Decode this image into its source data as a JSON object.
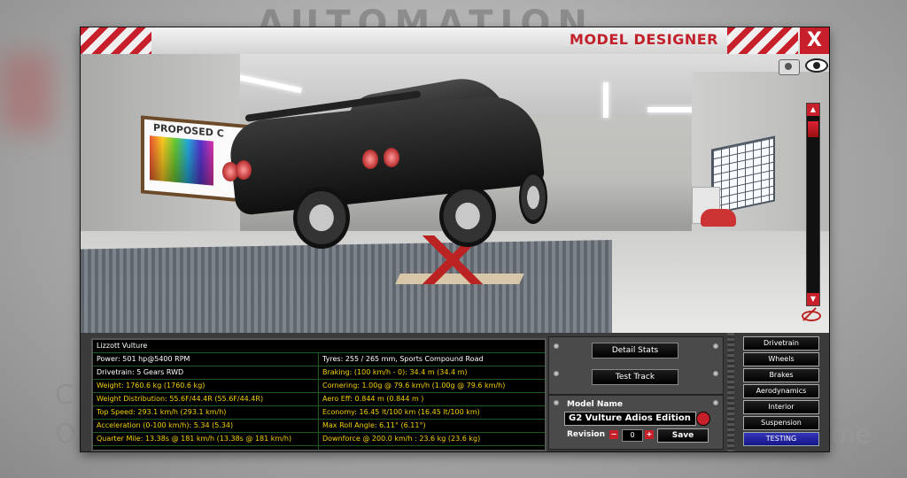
{
  "background": {
    "logo_text": "AUTOMATION",
    "left_text_1": "C",
    "left_text_2": "O",
    "right_text": "me"
  },
  "window": {
    "title": "MODEL DESIGNER",
    "close_label": "X"
  },
  "viewport": {
    "poster_text": "PROPOSED C"
  },
  "stats": {
    "model": "Lizzott Vulture",
    "rows": [
      {
        "left": "Power: 501 hp@5400 RPM",
        "left_color": "white",
        "right": "Tyres: 255 / 265 mm, Sports Compound Road",
        "right_color": "white"
      },
      {
        "left": "Drivetrain: 5 Gears RWD",
        "left_color": "white",
        "right": "Braking: (100 km/h - 0): 34.4 m (34.4 m)",
        "right_color": "yellow"
      },
      {
        "left": "Weight: 1760.6 kg (1760.6 kg)",
        "left_color": "yellow",
        "right": "Cornering: 1.00g @ 79.6 km/h (1.00g @ 79.6 km/h)",
        "right_color": "yellow"
      },
      {
        "left": "Weight Distribution: 55.6F/44.4R (55.6F/44.4R)",
        "left_color": "yellow",
        "right": "Aero Eff: 0.844 m  (0.844 m )",
        "right_color": "yellow"
      },
      {
        "left": "Top Speed: 293.1 km/h (293.1 km/h)",
        "left_color": "yellow",
        "right": "Economy: 16.45 lt/100 km (16.45 lt/100 km)",
        "right_color": "yellow"
      },
      {
        "left": "Acceleration (0-100 km/h): 5.34 (5.34)",
        "left_color": "yellow",
        "right": "Max Roll Angle: 6.11° (6.11°)",
        "right_color": "yellow"
      },
      {
        "left": "Quarter Mile: 13.38s @ 181 km/h (13.38s @ 181 km/h)",
        "left_color": "yellow",
        "right": "Downforce @ 200.0 km/h : 23.6 kg (23.6 kg)",
        "right_color": "yellow"
      }
    ]
  },
  "actions": {
    "detail_stats": "Detail Stats",
    "test_track": "Test Track"
  },
  "model_panel": {
    "name_label": "Model Name",
    "name_value": "G2 Vulture Adios Edition",
    "revision_label": "Revision",
    "revision_value": "0",
    "minus": "−",
    "plus": "+",
    "save_label": "Save"
  },
  "nav": {
    "items": [
      "Drivetrain",
      "Wheels",
      "Brakes",
      "Aerodynamics",
      "Interior",
      "Suspension",
      "TESTING"
    ],
    "active": "TESTING"
  },
  "colors": {
    "accent_red": "#c8202a",
    "stat_yellow": "#f2d000",
    "active_tab_blue": "#2525a8"
  }
}
